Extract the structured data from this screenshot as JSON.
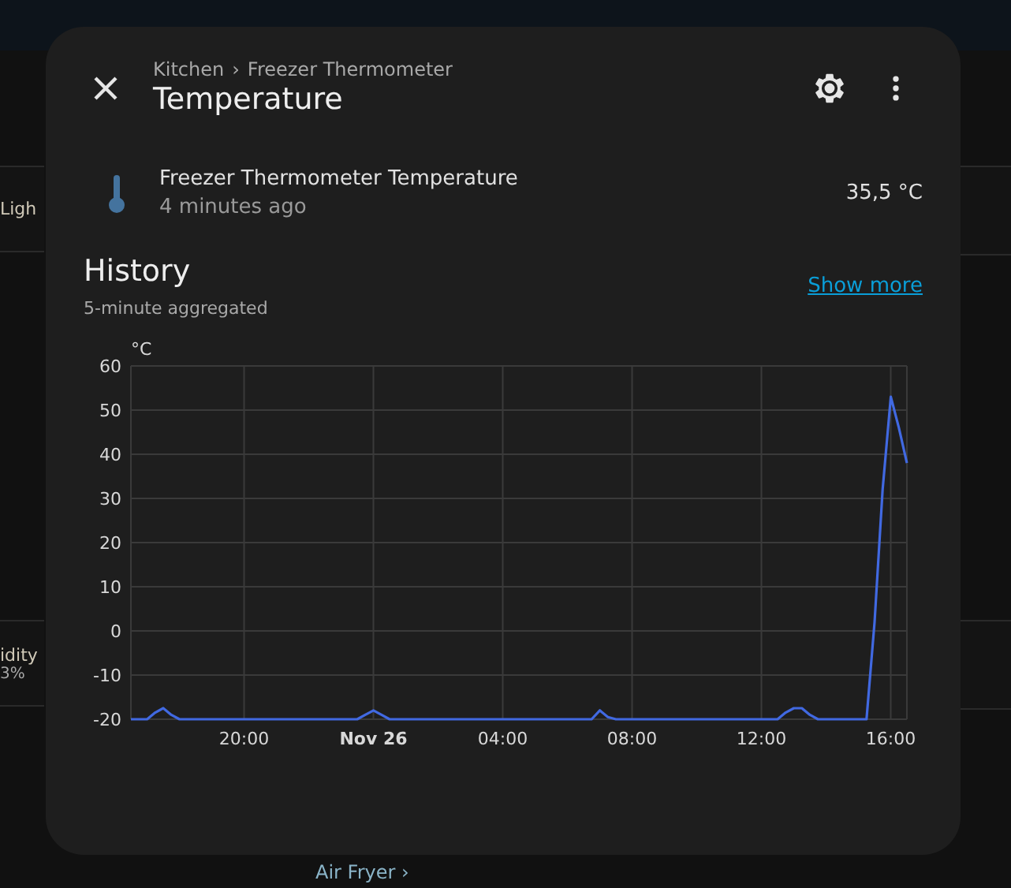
{
  "background": {
    "cards": [
      {
        "texts": [
          {
            "text": "Ligh",
            "kind": "title"
          }
        ]
      },
      {
        "texts": [
          {
            "text": "idity",
            "kind": "title"
          },
          {
            "text": "3%",
            "kind": "sub"
          }
        ]
      }
    ],
    "bottom_link": {
      "label": "Air Fryer",
      "chevron": "›"
    }
  },
  "dialog": {
    "breadcrumb": [
      "Kitchen",
      "Freezer Thermometer"
    ],
    "breadcrumb_separator": "›",
    "title": "Temperature",
    "entity": {
      "name": "Freezer Thermometer Temperature",
      "updated": "4 minutes ago",
      "state": "35,5 °C"
    },
    "history": {
      "title": "History",
      "subtitle": "5-minute aggregated",
      "link": "Show more",
      "chart_data": {
        "type": "line",
        "ylabel": "°C",
        "ylim": [
          -20,
          60
        ],
        "grid": true,
        "yticks": [
          -20,
          -10,
          0,
          10,
          20,
          30,
          40,
          50,
          60
        ],
        "categories": [
          null,
          null,
          null,
          null,
          null,
          null,
          null,
          null,
          null,
          null,
          null,
          null,
          null,
          null,
          "20:00",
          null,
          null,
          null,
          null,
          null,
          null,
          null,
          null,
          null,
          null,
          null,
          null,
          null,
          null,
          null,
          "Nov 26",
          null,
          null,
          null,
          null,
          null,
          null,
          null,
          null,
          null,
          null,
          null,
          null,
          null,
          null,
          null,
          "04:00",
          null,
          null,
          null,
          null,
          null,
          null,
          null,
          null,
          null,
          null,
          null,
          null,
          null,
          null,
          null,
          "08:00",
          null,
          null,
          null,
          null,
          null,
          null,
          null,
          null,
          null,
          null,
          null,
          null,
          null,
          null,
          null,
          "12:00",
          null,
          null,
          null,
          null,
          null,
          null,
          null,
          null,
          null,
          null,
          null,
          null,
          null,
          null,
          null,
          "16:00",
          null,
          null
        ],
        "series": [
          {
            "color": "#4169e1",
            "values": [
              -20,
              -20,
              -20,
              -18.5,
              -17.5,
              -19,
              -20,
              -20,
              -20,
              -20,
              -20,
              -20,
              -20,
              -20,
              -20,
              -20,
              -20,
              -20,
              -20,
              -20,
              -20,
              -20,
              -20,
              -20,
              -20,
              -20,
              -20,
              -20,
              -20,
              -19,
              -18,
              -19,
              -20,
              -20,
              -20,
              -20,
              -20,
              -20,
              -20,
              -20,
              -20,
              -20,
              -20,
              -20,
              -20,
              -20,
              -20,
              -20,
              -20,
              -20,
              -20,
              -20,
              -20,
              -20,
              -20,
              -20,
              -20,
              -20,
              -18,
              -19.5,
              -20,
              -20,
              -20,
              -20,
              -20,
              -20,
              -20,
              -20,
              -20,
              -20,
              -20,
              -20,
              -20,
              -20,
              -20,
              -20,
              -20,
              -20,
              -20,
              -20,
              -20,
              -18.5,
              -17.5,
              -17.5,
              -19,
              -20,
              -20,
              -20,
              -20,
              -20,
              -20,
              -20,
              2,
              32,
              53,
              46,
              38
            ]
          }
        ]
      }
    }
  }
}
